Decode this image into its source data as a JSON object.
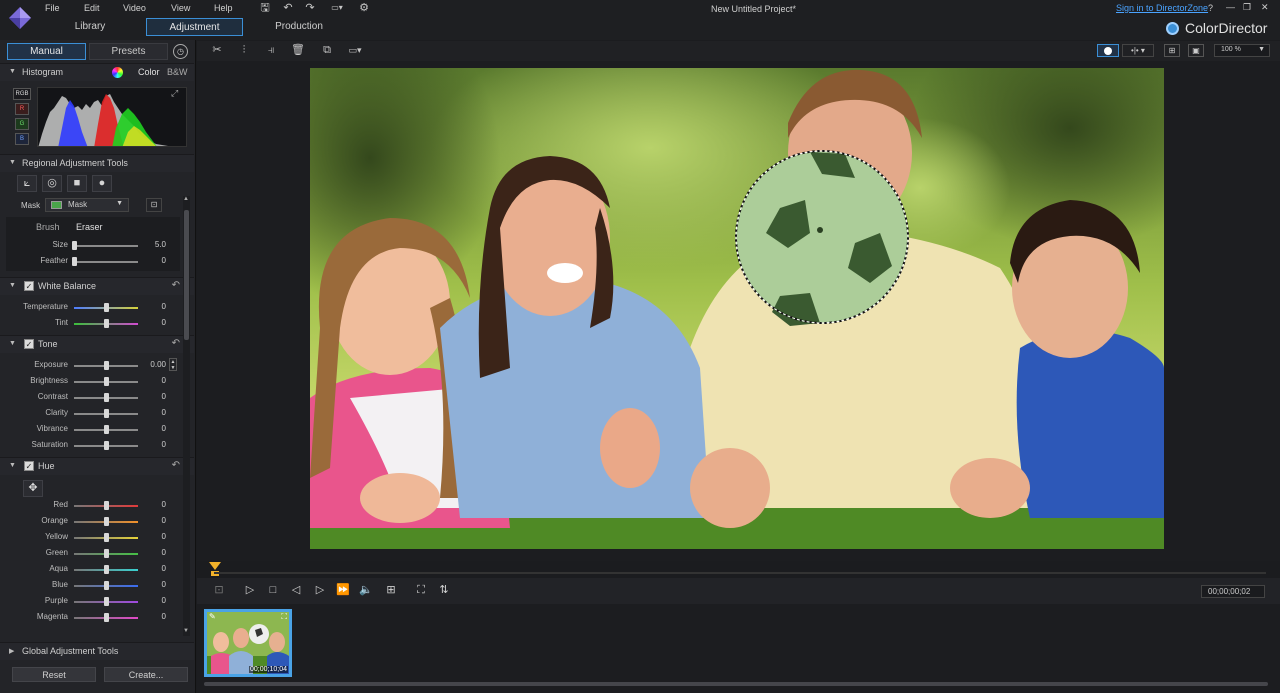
{
  "menu": [
    "File",
    "Edit",
    "Video",
    "View",
    "Help"
  ],
  "modes": [
    "Library",
    "Adjustment",
    "Production"
  ],
  "active_mode": "Adjustment",
  "project_title": "New Untitled Project*",
  "signin_link": "Sign in to DirectorZone",
  "window_controls": [
    "?",
    "—",
    "❐",
    "✕"
  ],
  "brand": "ColorDirector",
  "panel_tabs": [
    "Manual",
    "Presets"
  ],
  "histogram": {
    "title": "Histogram",
    "color_label": "Color",
    "bw_label": "B&W",
    "channels": [
      "RGB",
      "R",
      "G",
      "B"
    ]
  },
  "regional": {
    "title": "Regional Adjustment Tools",
    "mask_label": "Mask",
    "mask_value": "Mask",
    "brush_label": "Brush",
    "eraser_label": "Eraser",
    "sliders": [
      {
        "label": "Size",
        "value": "5.0",
        "pos": 0.0
      },
      {
        "label": "Feather",
        "value": "0",
        "pos": 0.0
      }
    ]
  },
  "white_balance": {
    "title": "White Balance",
    "sliders": [
      {
        "label": "Temperature",
        "value": "0",
        "pos": 0.5
      },
      {
        "label": "Tint",
        "value": "0",
        "pos": 0.5
      }
    ]
  },
  "tone": {
    "title": "Tone",
    "sliders": [
      {
        "label": "Exposure",
        "value": "0.00",
        "pos": 0.5
      },
      {
        "label": "Brightness",
        "value": "0",
        "pos": 0.5
      },
      {
        "label": "Contrast",
        "value": "0",
        "pos": 0.5
      },
      {
        "label": "Clarity",
        "value": "0",
        "pos": 0.5
      },
      {
        "label": "Vibrance",
        "value": "0",
        "pos": 0.5
      },
      {
        "label": "Saturation",
        "value": "0",
        "pos": 0.5
      }
    ]
  },
  "hue": {
    "title": "Hue",
    "sliders": [
      {
        "label": "Red",
        "value": "0",
        "pos": 0.5
      },
      {
        "label": "Orange",
        "value": "0",
        "pos": 0.5
      },
      {
        "label": "Yellow",
        "value": "0",
        "pos": 0.5
      },
      {
        "label": "Green",
        "value": "0",
        "pos": 0.5
      },
      {
        "label": "Aqua",
        "value": "0",
        "pos": 0.5
      },
      {
        "label": "Blue",
        "value": "0",
        "pos": 0.5
      },
      {
        "label": "Purple",
        "value": "0",
        "pos": 0.5
      },
      {
        "label": "Magenta",
        "value": "0",
        "pos": 0.5
      }
    ]
  },
  "global": {
    "title": "Global Adjustment Tools"
  },
  "buttons": {
    "reset": "Reset",
    "create": "Create..."
  },
  "zoom": "100 %",
  "timecode": "00;00;00;02",
  "thumbnail_timecode": "00;00;10;04",
  "colors": {
    "accent": "#3b8fd6",
    "signin": "#4aa3ff",
    "background": "#1b1c1f",
    "panel": "#232428"
  }
}
